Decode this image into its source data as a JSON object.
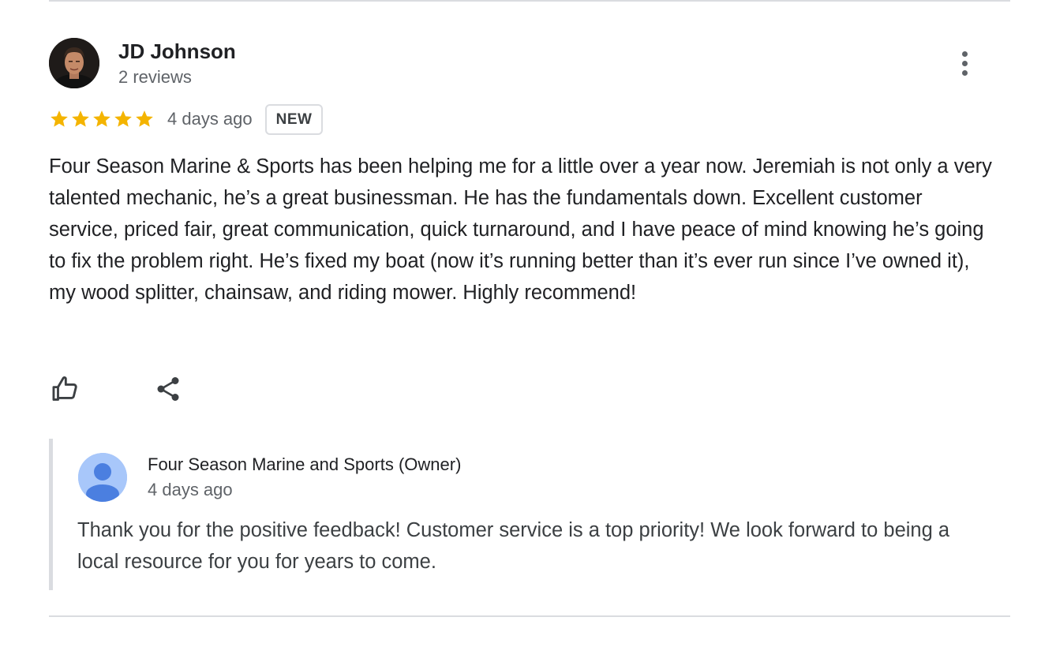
{
  "review": {
    "author_name": "JD Johnson",
    "author_meta": "2 reviews",
    "rating": 5,
    "rating_max": 5,
    "date": "4 days ago",
    "badge": "NEW",
    "text": "Four Season Marine & Sports has been helping me for a little over a year now. Jeremiah is not only a very talented mechanic, he’s a great businessman. He has the fundamentals down. Excellent customer service, priced fair, great communication, quick turnaround, and I have peace of mind knowing he’s going to fix the problem right. He’s fixed my boat (now it’s running better than it’s ever run since I’ve owned it), my wood splitter, chainsaw, and riding mower. Highly recommend!"
  },
  "owner_reply": {
    "name": "Four Season Marine and Sports (Owner)",
    "date": "4 days ago",
    "text": "Thank you for the positive feedback! Customer service is a top priority! We look forward to being a local resource for you for years to come."
  },
  "icons": {
    "more": "more-vert-icon",
    "like": "thumb-up-icon",
    "share": "share-icon",
    "star": "star-icon"
  },
  "colors": {
    "star": "#f4b400",
    "divider": "#dadce0",
    "secondary_text": "#5f6368",
    "owner_avatar_bg": "#a8c7fa",
    "owner_avatar_fg": "#4b7fe0"
  }
}
